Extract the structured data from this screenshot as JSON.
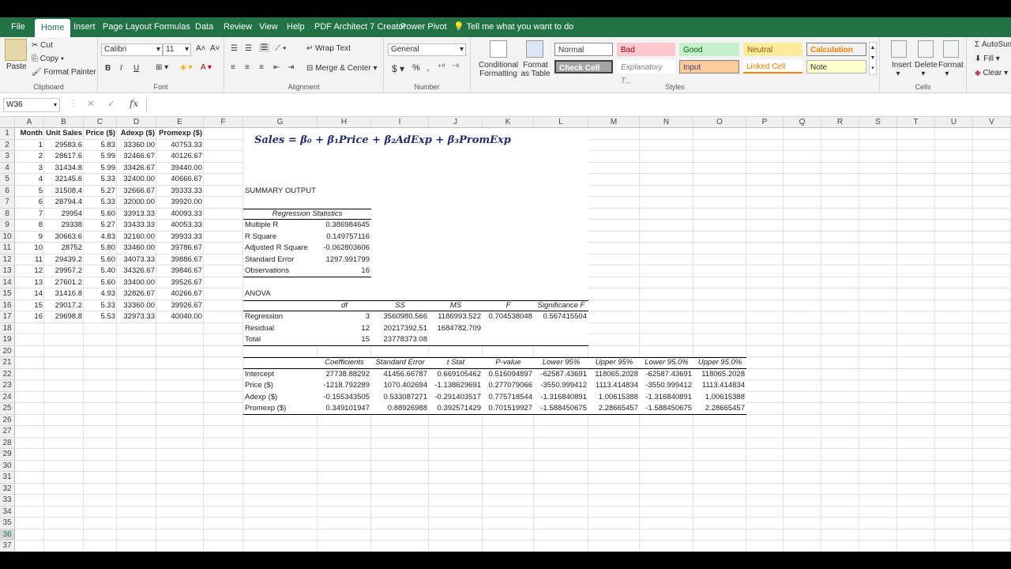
{
  "ribbon_tabs": [
    "File",
    "Home",
    "Insert",
    "Page Layout",
    "Formulas",
    "Data",
    "Review",
    "View",
    "Help",
    "PDF Architect 7 Creator",
    "Power Pivot"
  ],
  "tell_me": "Tell me what you want to do",
  "clipboard": {
    "paste": "Paste",
    "cut": "Cut",
    "copy": "Copy",
    "format_painter": "Format Painter",
    "label": "Clipboard"
  },
  "font": {
    "name": "Calibri",
    "size": "11",
    "label": "Font",
    "bold": "B",
    "italic": "I",
    "underline": "U"
  },
  "alignment": {
    "wrap": "Wrap Text",
    "merge": "Merge & Center",
    "label": "Alignment"
  },
  "number": {
    "format": "General",
    "currency": "$",
    "percent": "%",
    "comma": ",",
    "label": "Number"
  },
  "styles": {
    "conditional": "Conditional Formatting",
    "format_as_table": "Format as Table",
    "normal": "Normal",
    "bad": "Bad",
    "good": "Good",
    "neutral": "Neutral",
    "calculation": "Calculation",
    "check_cell": "Check Cell",
    "explanatory": "Explanatory T...",
    "input": "Input",
    "linked_cell": "Linked Cell",
    "note": "Note",
    "label": "Styles"
  },
  "cells": {
    "insert": "Insert",
    "delete": "Delete",
    "format": "Format",
    "label": "Cells"
  },
  "editing": {
    "autosum": "AutoSum",
    "fill": "Fill",
    "clear": "Clear"
  },
  "name_box": "W36",
  "columns": [
    "A",
    "B",
    "C",
    "D",
    "E",
    "F",
    "G",
    "H",
    "I",
    "J",
    "K",
    "L",
    "M",
    "N",
    "O",
    "P",
    "Q",
    "R",
    "S",
    "T",
    "U",
    "V"
  ],
  "rows": [
    "1",
    "2",
    "3",
    "4",
    "5",
    "6",
    "7",
    "8",
    "9",
    "10",
    "11",
    "12",
    "13",
    "14",
    "15",
    "16",
    "17",
    "18",
    "19",
    "20",
    "21",
    "22",
    "23",
    "24",
    "25",
    "26",
    "27",
    "28",
    "29",
    "30",
    "31",
    "32",
    "33",
    "34",
    "35",
    "36",
    "37"
  ],
  "data_headers": [
    "Month",
    "Unit Sales",
    "Price ($)",
    "Adexp ($)",
    "Promexp ($)"
  ],
  "data_rows": [
    [
      "1",
      "29583.6",
      "5.83",
      "33360.00",
      "40753.33"
    ],
    [
      "2",
      "28617.6",
      "5.99",
      "32466.67",
      "40126.67"
    ],
    [
      "3",
      "31434.8",
      "5.99",
      "33426.67",
      "39440.00"
    ],
    [
      "4",
      "32145.6",
      "5.33",
      "32400.00",
      "40666.67"
    ],
    [
      "5",
      "31508.4",
      "5.27",
      "32666.67",
      "39333.33"
    ],
    [
      "6",
      "28794.4",
      "5.33",
      "32000.00",
      "39920.00"
    ],
    [
      "7",
      "29954",
      "5.60",
      "33913.33",
      "40093.33"
    ],
    [
      "8",
      "29338",
      "5.27",
      "33433.33",
      "40053.33"
    ],
    [
      "9",
      "30663.6",
      "4.83",
      "32160.00",
      "39933.33"
    ],
    [
      "10",
      "28752",
      "5.80",
      "33460.00",
      "39786.67"
    ],
    [
      "11",
      "29439.2",
      "5.60",
      "34073.33",
      "39886.67"
    ],
    [
      "12",
      "29957.2",
      "5.40",
      "34326.67",
      "39846.67"
    ],
    [
      "13",
      "27601.2",
      "5.60",
      "33400.00",
      "39526.67"
    ],
    [
      "14",
      "31416.8",
      "4.93",
      "32826.67",
      "40266.67"
    ],
    [
      "15",
      "29017.2",
      "5.33",
      "33360.00",
      "39926.67"
    ],
    [
      "16",
      "29698.8",
      "5.53",
      "32973.33",
      "40040.00"
    ]
  ],
  "equation": "Sales  =  β₀  +  β₁Price  +  β₂AdExp  +  β₃PromExp",
  "summary_title": "SUMMARY OUTPUT",
  "reg_stats_title": "Regression Statistics",
  "reg_stats": [
    [
      "Multiple R",
      "0.386984645"
    ],
    [
      "R Square",
      "0.149757116"
    ],
    [
      "Adjusted R Square",
      "-0.062803606"
    ],
    [
      "Standard Error",
      "1297.991799"
    ],
    [
      "Observations",
      "16"
    ]
  ],
  "anova_title": "ANOVA",
  "anova_headers": [
    "df",
    "SS",
    "MS",
    "F",
    "Significance F"
  ],
  "anova_rows": [
    [
      "Regression",
      "3",
      "3560980.566",
      "1186993.522",
      "0.704538048",
      "0.567415504"
    ],
    [
      "Residual",
      "12",
      "20217392.51",
      "1684782.709",
      "",
      ""
    ],
    [
      "Total",
      "15",
      "23778373.08",
      "",
      "",
      ""
    ]
  ],
  "coef_headers": [
    "Coefficients",
    "Standard Error",
    "t Stat",
    "P-value",
    "Lower 95%",
    "Upper 95%",
    "Lower 95.0%",
    "Upper 95.0%"
  ],
  "coef_rows": [
    [
      "Intercept",
      "27738.88292",
      "41456.66787",
      "0.669105462",
      "0.516094897",
      "-62587.43691",
      "118065.2028",
      "-62587.43691",
      "118065.2028"
    ],
    [
      "Price ($)",
      "-1218.792289",
      "1070.402694",
      "-1.138629691",
      "0.277079066",
      "-3550.999412",
      "1113.414834",
      "-3550.999412",
      "1113.414834"
    ],
    [
      "Adexp ($)",
      "-0.155343505",
      "0.533087271",
      "-0.291403517",
      "0.775718544",
      "-1.316840891",
      "1.00615388",
      "-1.316840891",
      "1.00615388"
    ],
    [
      "Promexp ($)",
      "0.349101947",
      "0.88926988",
      "0.392571429",
      "0.701519927",
      "-1.588450675",
      "2.28665457",
      "-1.588450675",
      "2.28665457"
    ]
  ],
  "colors": {
    "excel_green": "#217346",
    "good_bg": "#c6efce",
    "bad_bg": "#ffc7ce",
    "neutral_bg": "#ffeb9c",
    "input_bg": "#ffcc99",
    "check_bg": "#a5a5a5",
    "equation": "#1f2f6e"
  }
}
